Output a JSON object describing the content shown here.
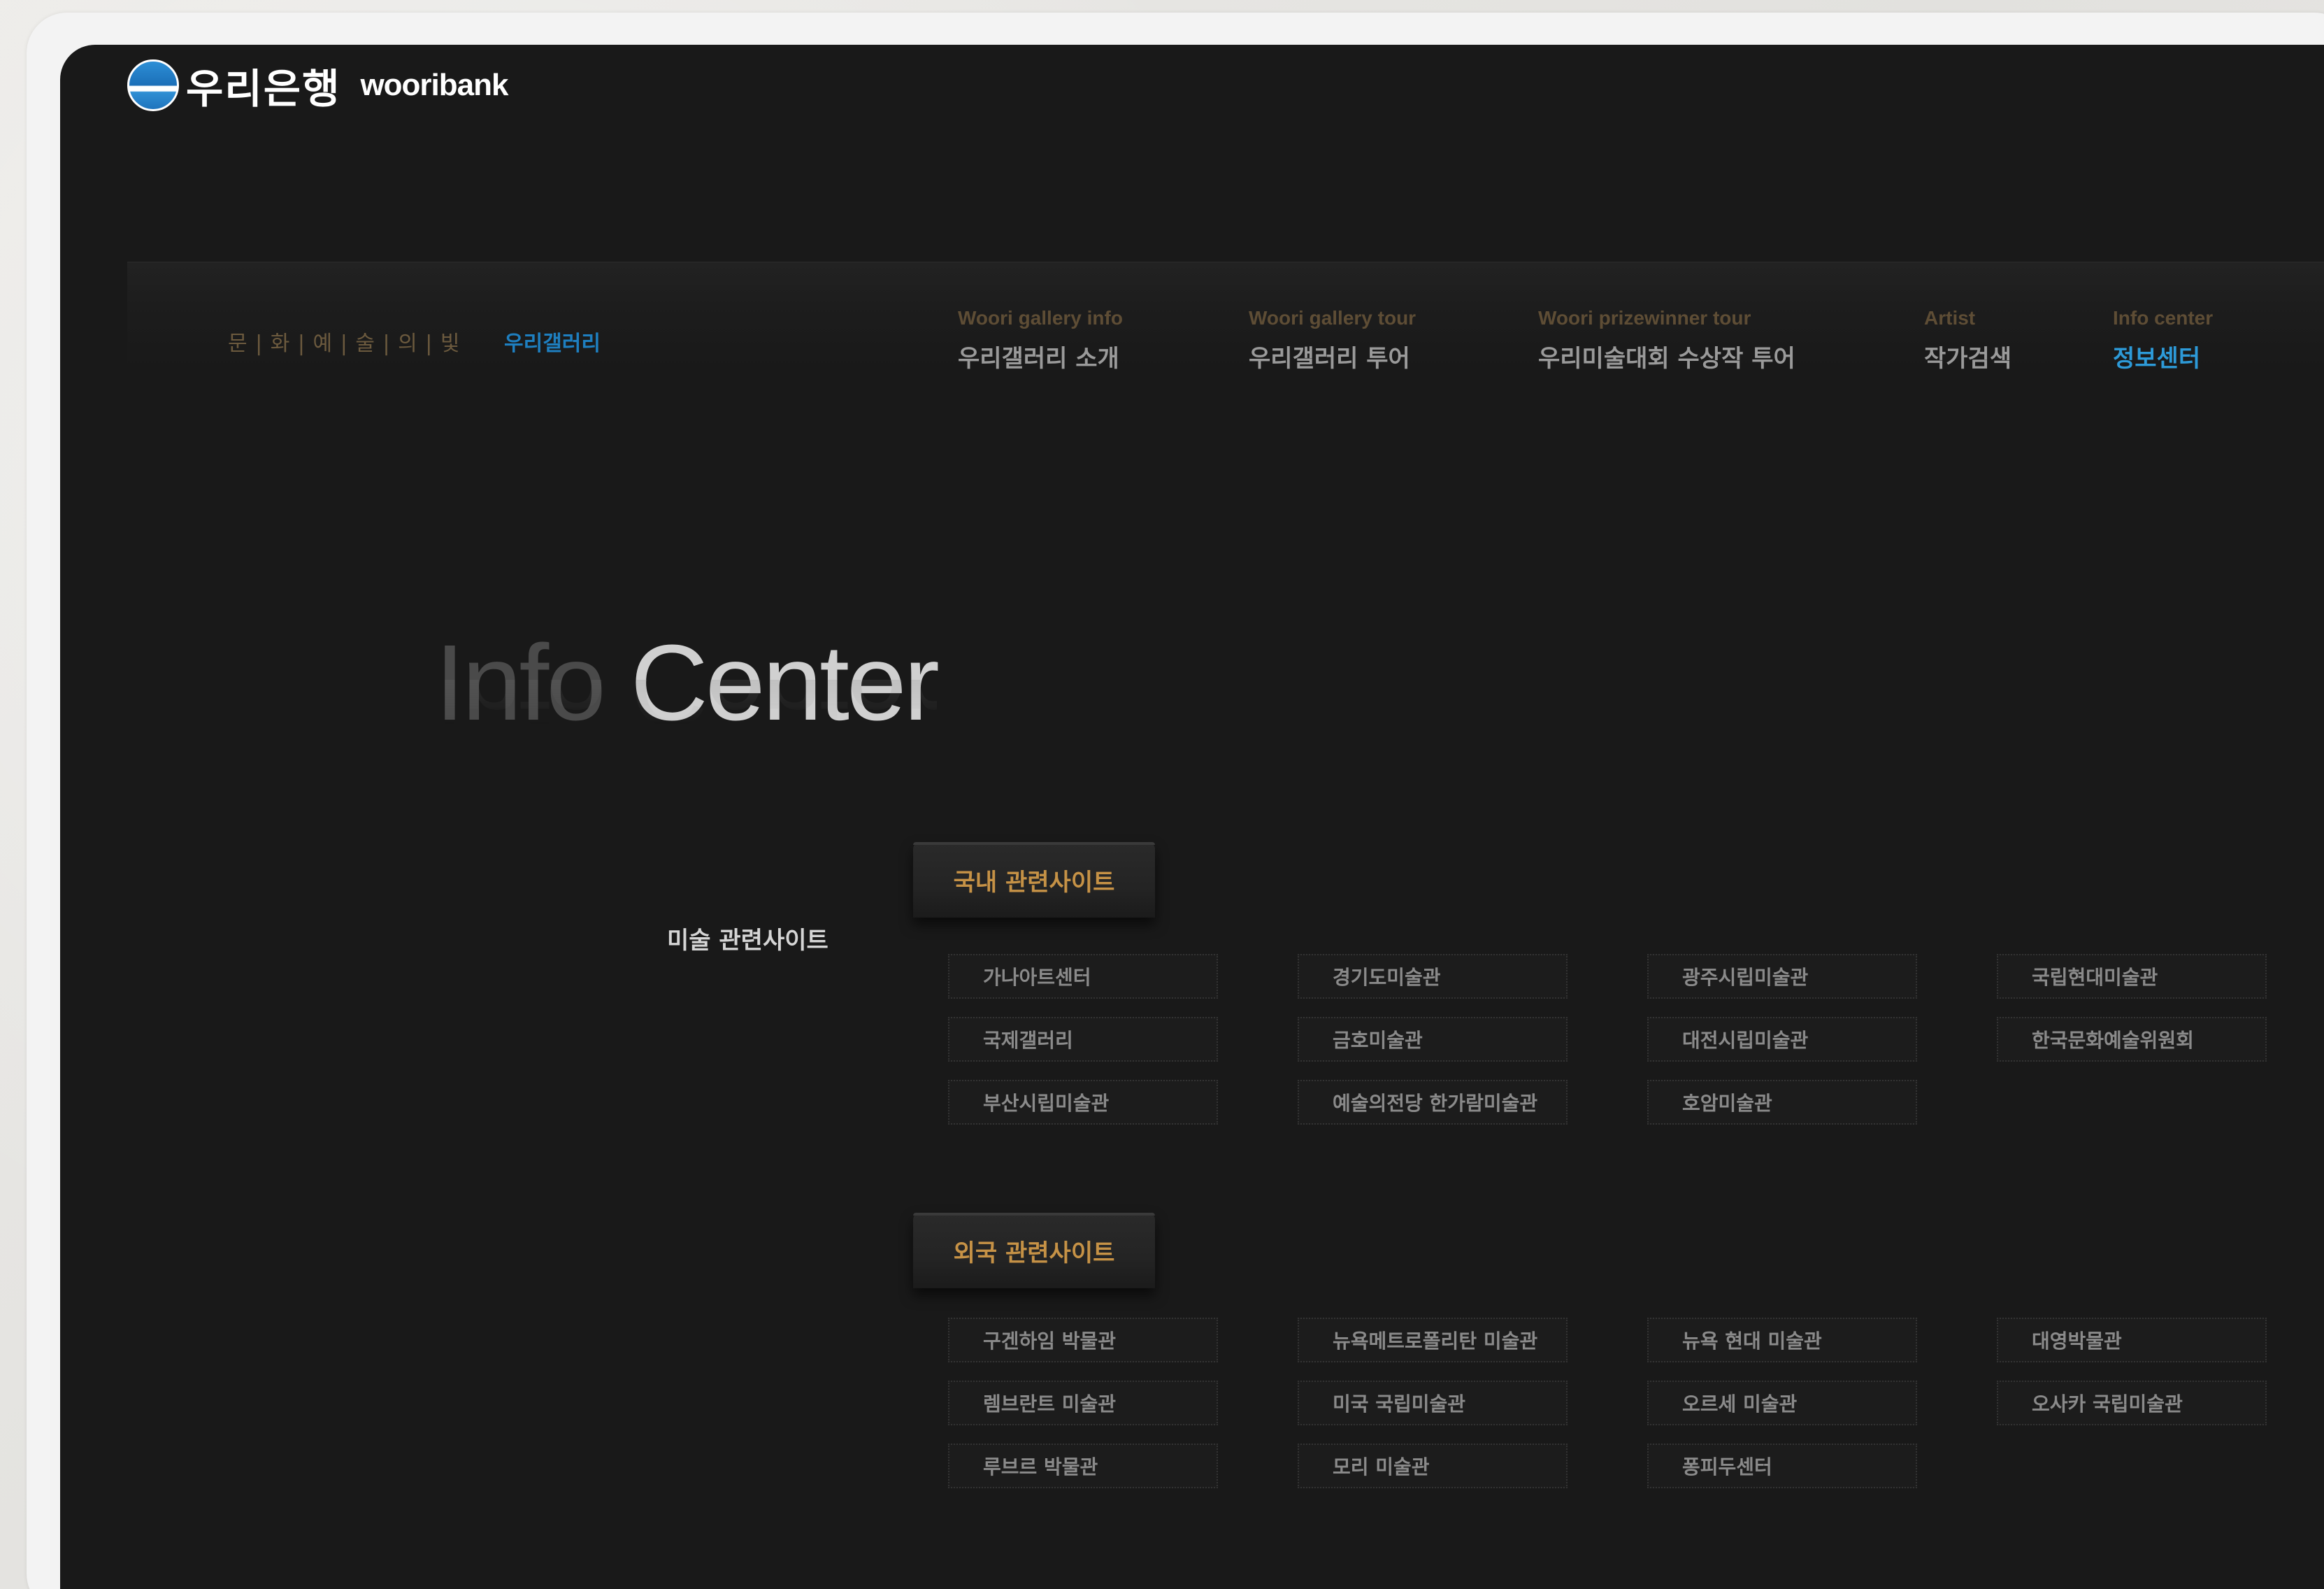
{
  "brand": {
    "name_ko": "우리은행",
    "name_en": "wooribank",
    "logo_icon": "woori-bank-logo-icon"
  },
  "breadcrumb": {
    "culture": "문 | 화 | 예 | 술 | 의 | 빛",
    "gallery": "우리갤러리"
  },
  "nav": [
    {
      "en": "Woori gallery info",
      "ko": "우리갤러리 소개",
      "active": false
    },
    {
      "en": "Woori gallery tour",
      "ko": "우리갤러리 투어",
      "active": false
    },
    {
      "en": "Woori prizewinner tour",
      "ko": "우리미술대회 수상작 투어",
      "active": false
    },
    {
      "en": "Artist",
      "ko": "작가검색",
      "active": false
    },
    {
      "en": "Info center",
      "ko": "정보센터",
      "active": true
    }
  ],
  "page": {
    "title_light": "Info",
    "title_bold": "Center",
    "side_label": "미술 관련사이트"
  },
  "sections": [
    {
      "label": "국내 관련사이트",
      "links": [
        "가나아트센터",
        "경기도미술관",
        "광주시립미술관",
        "국립현대미술관",
        "국제갤러리",
        "금호미술관",
        "대전시립미술관",
        "한국문화예술위원회",
        "부산시립미술관",
        "예술의전당 한가람미술관",
        "호암미술관"
      ]
    },
    {
      "label": "외국 관련사이트",
      "links": [
        "구겐하임 박물관",
        "뉴욕메트로폴리탄 미술관",
        "뉴욕 현대 미술관",
        "대영박물관",
        "렘브란트 미술관",
        "미국 국립미술관",
        "오르세 미술관",
        "오사카 국립미술관",
        "루브르 박물관",
        "모리 미술관",
        "퐁피두센터"
      ]
    }
  ],
  "colors": {
    "background": "#191919",
    "accent_blue": "#2d9ad8",
    "accent_gold": "#c69246",
    "nav_en": "#5e4d35"
  }
}
